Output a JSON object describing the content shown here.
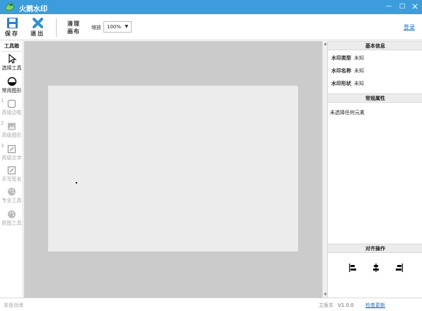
{
  "app": {
    "title": "火鹅水印"
  },
  "window_controls": {
    "minimize": "—",
    "maximize": "□",
    "close": "×"
  },
  "toolbar": {
    "save_label": "保存",
    "exit_label": "退出",
    "clear_line1": "清理",
    "clear_line2": "画布",
    "zoom_label": "缩放",
    "zoom_value": "100%",
    "login_label": "登录"
  },
  "left_panel": {
    "header": "工具箱",
    "tools": [
      {
        "label": "选择工具",
        "icon": "cursor-icon",
        "enabled": true,
        "num": ""
      },
      {
        "label": "常用图形",
        "icon": "circle-shape-icon",
        "enabled": true,
        "num": ""
      },
      {
        "label": "高级边框",
        "icon": "border-icon",
        "enabled": false,
        "num": "1"
      },
      {
        "label": "高级图形",
        "icon": "image-icon",
        "enabled": false,
        "num": "2"
      },
      {
        "label": "高级文字",
        "icon": "text-edit-icon",
        "enabled": false,
        "num": "3"
      },
      {
        "label": "手写签名",
        "icon": "signature-icon",
        "enabled": false,
        "num": ""
      },
      {
        "label": "专业工具",
        "icon": "palette-icon",
        "enabled": false,
        "num": ""
      },
      {
        "label": "抠图工具",
        "icon": "palette-icon",
        "enabled": false,
        "num": ""
      }
    ]
  },
  "right_panel": {
    "basic_info_title": "基本信息",
    "rows": [
      {
        "key": "水印类型",
        "value": "未知"
      },
      {
        "key": "水印名称",
        "value": "未知"
      },
      {
        "key": "水印形状",
        "value": "未知"
      }
    ],
    "properties_title": "常规属性",
    "no_selection": "未选择任何元素",
    "align_title": "对齐操作"
  },
  "statusbar": {
    "left_text": "准备就绪",
    "version_label": "主版本",
    "version_value": "V1.0.0",
    "update_label": "检查更新"
  },
  "colors": {
    "titlebar": "#3d9ddc",
    "canvas_bg": "#cbcbcb",
    "paper": "#ececec",
    "link": "#1a6fc9"
  }
}
